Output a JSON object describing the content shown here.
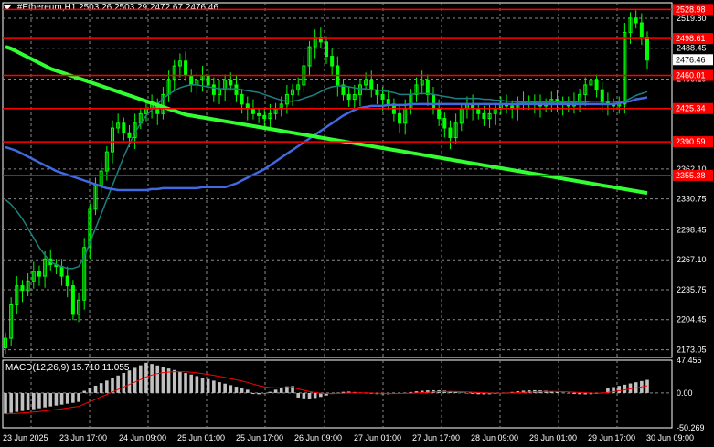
{
  "header": {
    "symbol": "#Ethereum,H1",
    "ohlc": "2503.26 2503.29 2472.67 2476.46"
  },
  "macd": {
    "label": "MACD(12,26,9) 15.710 11.055",
    "axis_labels": [
      "47.455",
      "0.00",
      "-50.269"
    ],
    "axis_values": [
      47.455,
      0,
      -50.269
    ]
  },
  "price_axis": {
    "labels": [
      "2519.80",
      "2488.45",
      "2456.19",
      "2362.10",
      "2330.75",
      "2298.45",
      "2267.10",
      "2235.75",
      "2204.45",
      "2173.05"
    ],
    "values": [
      2519.8,
      2488.45,
      2456.19,
      2362.1,
      2330.75,
      2298.45,
      2267.1,
      2235.75,
      2204.45,
      2173.05
    ],
    "min": 2165,
    "max": 2536
  },
  "current_price": {
    "label": "2476.46",
    "value": 2476.46
  },
  "levels": {
    "color": "#ff0000",
    "items": [
      {
        "label": "2528.98",
        "value": 2528.98
      },
      {
        "label": "2498.61",
        "value": 2498.61
      },
      {
        "label": "2460.01",
        "value": 2460.01
      },
      {
        "label": "2425.34",
        "value": 2425.34
      },
      {
        "label": "2390.59",
        "value": 2390.59
      },
      {
        "label": "2355.38",
        "value": 2355.38
      }
    ]
  },
  "time_axis": {
    "labels": [
      "23 Jun 2025",
      "23 Jun 17:00",
      "24 Jun 09:00",
      "25 Jun 01:00",
      "25 Jun 17:00",
      "26 Jun 09:00",
      "27 Jun 01:00",
      "27 Jun 17:00",
      "28 Jun 09:00",
      "29 Jun 01:00",
      "29 Jun 17:00",
      "30 Jun 09:00"
    ]
  },
  "colors": {
    "background": "#000000",
    "grid": "#8a8a8a",
    "candle": "#00ff00",
    "ma_fast": "#1e7f7f",
    "ma_mid": "#4169e1",
    "ma_slow": "#32ff32",
    "macd_hist": "#c0c0c0",
    "macd_signal": "#ff0000",
    "level_line": "#ff0000"
  },
  "chart_data": {
    "type": "line",
    "series": [
      {
        "values": [
          2185,
          2220,
          2240,
          2235,
          2245,
          2255,
          2250,
          2268,
          2262,
          2260,
          2250,
          2240,
          2210,
          2225,
          2280,
          2320,
          2345,
          2360,
          2380,
          2405,
          2410,
          2400,
          2395,
          2410,
          2420,
          2425,
          2430,
          2420,
          2440,
          2455,
          2470,
          2475,
          2460,
          2450,
          2455,
          2460,
          2450,
          2440,
          2445,
          2455,
          2450,
          2440,
          2430,
          2425,
          2420,
          2418,
          2415,
          2420,
          2425,
          2430,
          2440,
          2445,
          2450,
          2470,
          2490,
          2500,
          2495,
          2480,
          2470,
          2450,
          2440,
          2435,
          2440,
          2450,
          2455,
          2445,
          2440,
          2435,
          2430,
          2420,
          2410,
          2425,
          2440,
          2450,
          2455,
          2440,
          2425,
          2415,
          2405,
          2395,
          2410,
          2425,
          2430,
          2425,
          2420,
          2415,
          2420,
          2425,
          2430,
          2428,
          2425,
          2430,
          2433,
          2432,
          2430,
          2428,
          2430,
          2435,
          2432,
          2430,
          2428,
          2432,
          2440,
          2450,
          2455,
          2445,
          2432,
          2430,
          2428,
          2430,
          2505,
          2520,
          2515,
          2500,
          2476
        ]
      },
      {
        "values": [
          2330,
          2325,
          2318,
          2310,
          2300,
          2290,
          2280,
          2272,
          2265,
          2262,
          2260,
          2258,
          2258,
          2260,
          2270,
          2285,
          2300,
          2315,
          2330,
          2345,
          2360,
          2375,
          2388,
          2400,
          2410,
          2418,
          2424,
          2430,
          2436,
          2440,
          2444,
          2447,
          2449,
          2450,
          2450,
          2449,
          2448,
          2447,
          2446,
          2446,
          2446,
          2446,
          2445,
          2444,
          2443,
          2442,
          2440,
          2438,
          2436,
          2434,
          2433,
          2433,
          2434,
          2436,
          2438,
          2440,
          2443,
          2446,
          2448,
          2449,
          2449,
          2448,
          2447,
          2446,
          2446,
          2445,
          2445,
          2444,
          2443,
          2442,
          2440,
          2440,
          2440,
          2441,
          2441,
          2441,
          2440,
          2439,
          2438,
          2437,
          2436,
          2436,
          2436,
          2436,
          2436,
          2435,
          2435,
          2434,
          2434,
          2433,
          2433,
          2432,
          2432,
          2432,
          2432,
          2432,
          2432,
          2432,
          2432,
          2432,
          2432,
          2432,
          2432,
          2432,
          2433,
          2433,
          2433,
          2433,
          2433,
          2432,
          2433,
          2436,
          2439,
          2441,
          2443
        ]
      },
      {
        "values": [
          2385,
          2383,
          2381,
          2378,
          2375,
          2372,
          2369,
          2366,
          2363,
          2360,
          2358,
          2356,
          2354,
          2352,
          2350,
          2348,
          2346,
          2344,
          2342,
          2341,
          2340,
          2340,
          2340,
          2340,
          2340,
          2340,
          2341,
          2341,
          2342,
          2342,
          2342,
          2342,
          2342,
          2342,
          2342,
          2343,
          2343,
          2343,
          2343,
          2343,
          2345,
          2347,
          2350,
          2353,
          2356,
          2359,
          2362,
          2366,
          2370,
          2374,
          2378,
          2382,
          2386,
          2390,
          2394,
          2398,
          2402,
          2406,
          2410,
          2414,
          2418,
          2421,
          2424,
          2426,
          2427,
          2428,
          2428,
          2428,
          2429,
          2429,
          2429,
          2429,
          2430,
          2430,
          2430,
          2430,
          2430,
          2430,
          2430,
          2430,
          2430,
          2430,
          2430,
          2430,
          2430,
          2430,
          2430,
          2430,
          2430,
          2430,
          2430,
          2430,
          2430,
          2430,
          2430,
          2430,
          2430,
          2430,
          2430,
          2430,
          2430,
          2430,
          2430,
          2430,
          2430,
          2430,
          2430,
          2430,
          2430,
          2431,
          2432,
          2433,
          2435,
          2436,
          2437
        ]
      },
      {
        "values": [
          2490,
          2488,
          2485,
          2482,
          2479,
          2476,
          2473,
          2470,
          2467,
          2465,
          2463,
          2461,
          2459,
          2457,
          2455,
          2453,
          2451,
          2449,
          2447,
          2445,
          2443,
          2441,
          2439,
          2437,
          2435,
          2433,
          2431,
          2429,
          2427,
          2425,
          2423,
          2421,
          2419,
          2418,
          2417,
          2416,
          2415,
          2414,
          2413,
          2412,
          2411,
          2410,
          2409,
          2408,
          2407,
          2406,
          2405,
          2404,
          2403,
          2402,
          2401,
          2400,
          2399,
          2398,
          2397,
          2396,
          2395,
          2394,
          2393,
          2392,
          2391,
          2390,
          2389,
          2388,
          2387,
          2386,
          2385,
          2384,
          2383,
          2382,
          2381,
          2380,
          2379,
          2378,
          2377,
          2376,
          2375,
          2374,
          2373,
          2372,
          2371,
          2370,
          2369,
          2368,
          2367,
          2366,
          2365,
          2364,
          2363,
          2362,
          2361,
          2360,
          2359,
          2358,
          2357,
          2356,
          2355,
          2354,
          2353,
          2352,
          2351,
          2350,
          2349,
          2348,
          2347,
          2346,
          2345,
          2344,
          2343,
          2342,
          2341,
          2340,
          2339,
          2338,
          2337
        ]
      }
    ],
    "ylim": [
      2165,
      2536
    ]
  }
}
